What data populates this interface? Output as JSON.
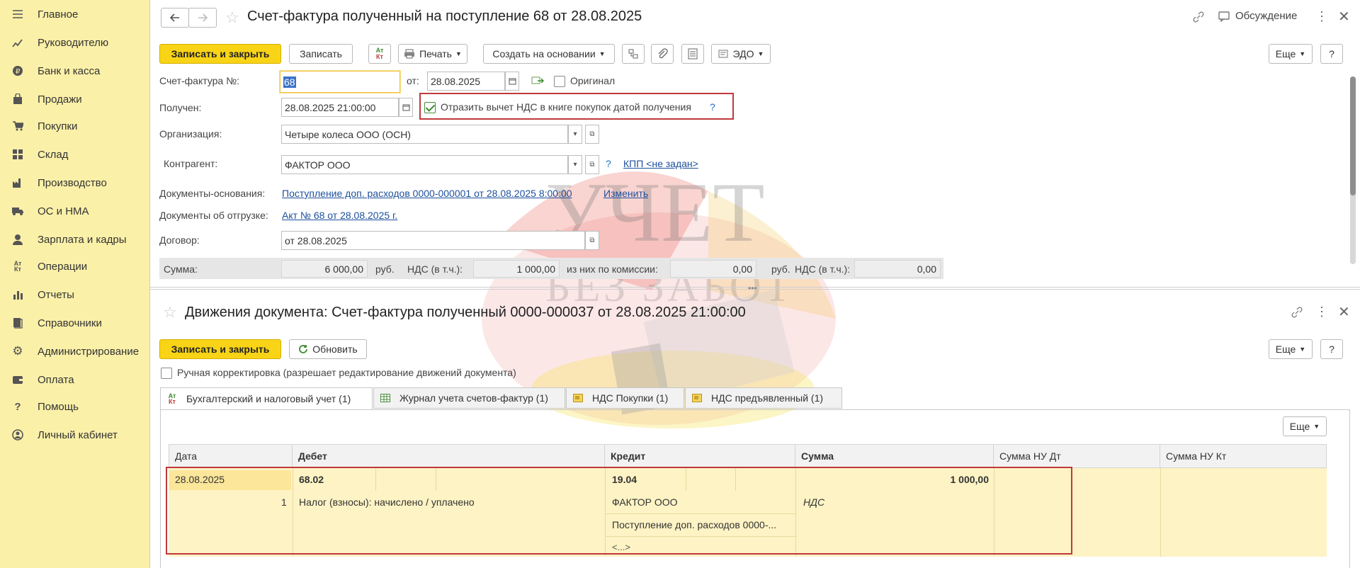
{
  "sidebar": {
    "items": [
      {
        "label": "Главное",
        "icon": "menu-icon"
      },
      {
        "label": "Руководителю",
        "icon": "chart-line-icon"
      },
      {
        "label": "Банк и касса",
        "icon": "ruble-coin-icon"
      },
      {
        "label": "Продажи",
        "icon": "shopping-bag-icon"
      },
      {
        "label": "Покупки",
        "icon": "shopping-cart-icon"
      },
      {
        "label": "Склад",
        "icon": "warehouse-grid-icon"
      },
      {
        "label": "Производство",
        "icon": "factory-icon"
      },
      {
        "label": "ОС и НМА",
        "icon": "truck-icon"
      },
      {
        "label": "Зарплата и кадры",
        "icon": "person-icon"
      },
      {
        "label": "Операции",
        "icon": "debit-credit-icon"
      },
      {
        "label": "Отчеты",
        "icon": "bar-chart-icon"
      },
      {
        "label": "Справочники",
        "icon": "books-icon"
      },
      {
        "label": "Администрирование",
        "icon": "gear-icon"
      },
      {
        "label": "Оплата",
        "icon": "wallet-icon"
      },
      {
        "label": "Помощь",
        "icon": "question-icon"
      },
      {
        "label": "Личный кабинет",
        "icon": "user-circle-icon"
      }
    ]
  },
  "doc": {
    "title": "Счет-фактура полученный на поступление 68 от 28.08.2025",
    "discussion_label": "Обсуждение",
    "toolbar": {
      "save_close": "Записать и закрыть",
      "save": "Записать",
      "print": "Печать",
      "create_based": "Создать на основании",
      "edo": "ЭДО",
      "more": "Еще",
      "help": "?"
    },
    "form": {
      "number_label": "Счет-фактура №:",
      "number_value": "68",
      "from_label": "от:",
      "date_value": "28.08.2025",
      "original_label": "Оригинал",
      "received_label": "Получен:",
      "received_value": "28.08.2025 21:00:00",
      "vat_deduct_label": "Отразить вычет НДС в книге покупок датой получения",
      "vat_help": "?",
      "org_label": "Организация:",
      "org_value": "Четыре колеса ООО (ОСН)",
      "contractor_label": "Контрагент:",
      "contractor_value": "ФАКТОР ООО",
      "contractor_help": "?",
      "kpp_link": "КПП <не задан>",
      "base_docs_label": "Документы-основания:",
      "base_docs_link": "Поступление доп. расходов 0000-000001 от 28.08.2025 8:00:00",
      "change_link": "Изменить",
      "shipment_label": "Документы об отгрузке:",
      "shipment_link": "Акт № 68 от 28.08.2025 г.",
      "contract_label": "Договор:",
      "contract_value": "от 28.08.2025"
    },
    "totals": {
      "sum_label": "Сумма:",
      "sum_value": "6 000,00",
      "currency1": "руб.",
      "vat_label": "НДС (в т.ч.):",
      "vat_value": "1 000,00",
      "commission_label": "из них по комиссии:",
      "commission_value": "0,00",
      "currency2": "руб.",
      "vat2_label": "НДС (в т.ч.):",
      "vat2_value": "0,00"
    }
  },
  "movements": {
    "title": "Движения документа: Счет-фактура полученный 0000-000037 от 28.08.2025 21:00:00",
    "toolbar": {
      "save_close": "Записать и закрыть",
      "refresh": "Обновить",
      "more": "Еще",
      "help": "?"
    },
    "manual_label": "Ручная корректировка (разрешает редактирование движений документа)",
    "tabs": [
      {
        "label": "Бухгалтерский и налоговый учет (1)",
        "icon": "debit-credit-icon"
      },
      {
        "label": "Журнал учета счетов-фактур (1)",
        "icon": "table-icon"
      },
      {
        "label": "НДС Покупки (1)",
        "icon": "register-icon"
      },
      {
        "label": "НДС предъявленный (1)",
        "icon": "register-icon"
      }
    ],
    "grid_more": "Еще",
    "columns": [
      "Дата",
      "Дебет",
      "Кредит",
      "Сумма",
      "Сумма НУ Дт",
      "Сумма НУ Кт"
    ],
    "row": {
      "date": "28.08.2025",
      "num": "1",
      "debit_account": "68.02",
      "debit_sub": "Налог (взносы): начислено / уплачено",
      "credit_account": "19.04",
      "credit_sub1": "ФАКТОР ООО",
      "credit_sub2": "Поступление доп. расходов 0000-...",
      "credit_sub3": "<...>",
      "amount": "1 000,00",
      "amount_note": "НДС"
    }
  },
  "watermark": {
    "line1": "УЧЕТ",
    "line2": "БЕЗ ЗАБОТ"
  }
}
